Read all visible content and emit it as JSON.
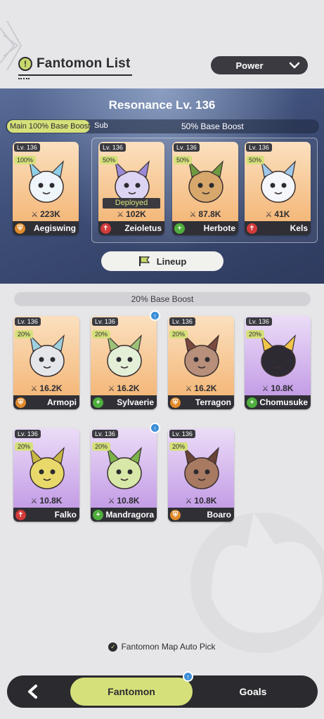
{
  "header": {
    "title": "Fantomon List",
    "sort_label": "Power"
  },
  "resonance": {
    "title": "Resonance Lv. 136",
    "main_tag": "Main",
    "main_boost": "100% Base Boost",
    "sub_tag": "Sub",
    "sub_boost": "50% Base Boost",
    "lineup_label": "Lineup",
    "team": [
      {
        "level": "Lv. 136",
        "boost": "100%",
        "power": "223K",
        "name": "Aegiswing",
        "role": "tank",
        "rarity": "orange",
        "deployed": ""
      },
      {
        "level": "Lv. 136",
        "boost": "50%",
        "power": "102K",
        "name": "Zeioletus",
        "role": "dps",
        "rarity": "orange",
        "deployed": "Deployed"
      },
      {
        "level": "Lv. 136",
        "boost": "50%",
        "power": "87.8K",
        "name": "Herbote",
        "role": "heal",
        "rarity": "orange",
        "deployed": ""
      },
      {
        "level": "Lv. 136",
        "boost": "50%",
        "power": "41K",
        "name": "Kels",
        "role": "dps",
        "rarity": "orange",
        "deployed": ""
      }
    ]
  },
  "reserve": {
    "boost_label": "20% Base Boost",
    "cards": [
      {
        "level": "Lv. 136",
        "boost": "20%",
        "power": "16.2K",
        "name": "Armopi",
        "role": "tank",
        "rarity": "orange",
        "notify": false
      },
      {
        "level": "Lv. 136",
        "boost": "20%",
        "power": "16.2K",
        "name": "Sylvaerie",
        "role": "heal",
        "rarity": "orange",
        "notify": true
      },
      {
        "level": "Lv. 136",
        "boost": "20%",
        "power": "16.2K",
        "name": "Terragon",
        "role": "tank",
        "rarity": "orange",
        "notify": false
      },
      {
        "level": "Lv. 136",
        "boost": "20%",
        "power": "10.8K",
        "name": "Chomusuke",
        "role": "heal",
        "rarity": "purple",
        "notify": false
      },
      {
        "level": "Lv. 136",
        "boost": "20%",
        "power": "10.8K",
        "name": "Falko",
        "role": "dps",
        "rarity": "purple",
        "notify": false
      },
      {
        "level": "Lv. 136",
        "boost": "20%",
        "power": "10.8K",
        "name": "Mandragora",
        "role": "heal",
        "rarity": "purple",
        "notify": true
      },
      {
        "level": "Lv. 136",
        "boost": "20%",
        "power": "10.8K",
        "name": "Boaro",
        "role": "tank",
        "rarity": "purple",
        "notify": false
      }
    ]
  },
  "auto_pick_label": "Fantomon Map Auto Pick",
  "nav": {
    "tab_fantomon": "Fantomon",
    "tab_goals": "Goals"
  },
  "colors": {
    "accent": "#d6e07a",
    "dark": "#2a2a2f",
    "orange_card": "#f4b87a",
    "purple_card": "#c49de6",
    "role_tank": "#e08a2a",
    "role_heal": "#4fae3d",
    "role_dps": "#d23b3b",
    "notify": "#3c8fd8"
  }
}
